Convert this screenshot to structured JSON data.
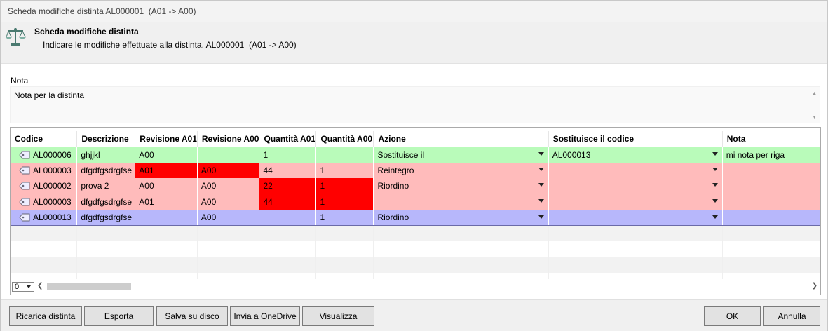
{
  "window": {
    "title": "Scheda modifiche distinta AL000001  (A01 -> A00)"
  },
  "header": {
    "icon": "balance-scale-icon",
    "title": "Scheda modifiche distinta",
    "subtitle": "Indicare le modifiche effettuate alla distinta. AL000001  (A01 -> A00)"
  },
  "nota": {
    "label": "Nota",
    "value": "Nota per la distinta"
  },
  "table": {
    "columns": [
      "Codice",
      "Descrizione",
      "Revisione A01",
      "Revisione A00",
      "Quantità A01",
      "Quantità A00",
      "Azione",
      "Sostituisce il codice",
      "Nota"
    ],
    "rows": [
      {
        "style": "green",
        "codice": "AL000006",
        "descrizione": "ghjjkl",
        "rev_a01": "A00",
        "rev_a00": "",
        "qta_a01": "1",
        "qta_a00": "",
        "azione": "Sostituisce il",
        "sostituisce": "AL000013",
        "nota": "mi nota per riga"
      },
      {
        "style": "pink",
        "codice": "AL000003",
        "descrizione": "dfgdfgsdrgfse",
        "rev_a01": "A01",
        "rev_a00": "A00",
        "qta_a01": "44",
        "qta_a00": "1",
        "azione": "Reintegro",
        "sostituisce": "",
        "nota": ""
      },
      {
        "style": "pink",
        "codice": "AL000002",
        "descrizione": "prova 2",
        "rev_a01": "A00",
        "rev_a00": "A00",
        "qta_a01": "22",
        "qta_a00": "1",
        "azione": "Riordino",
        "sostituisce": "",
        "nota": ""
      },
      {
        "style": "pink",
        "codice": "AL000003",
        "descrizione": "dfgdfgsdrgfse",
        "rev_a01": "A01",
        "rev_a00": "A00",
        "qta_a01": "44",
        "qta_a00": "1",
        "azione": "",
        "sostituisce": "",
        "nota": ""
      },
      {
        "style": "blue",
        "codice": "AL000013",
        "descrizione": "dfgdfgsdrgfse",
        "rev_a01": "",
        "rev_a00": "A00",
        "qta_a01": "",
        "qta_a00": "1",
        "azione": "Riordino",
        "sostituisce": "",
        "nota": ""
      }
    ],
    "zoom_value": "0"
  },
  "colors": {
    "green_row": "#b9fbba",
    "pink_row": "#ffbbbb",
    "blue_row": "#b7b7fb",
    "changed_cell": "#ff0000"
  },
  "footer": {
    "ricarica": "Ricarica distinta",
    "esporta": "Esporta",
    "salva": "Salva su disco",
    "onedrive": "Invia a OneDrive",
    "visualizza": "Visualizza",
    "ok": "OK",
    "annulla": "Annulla"
  }
}
